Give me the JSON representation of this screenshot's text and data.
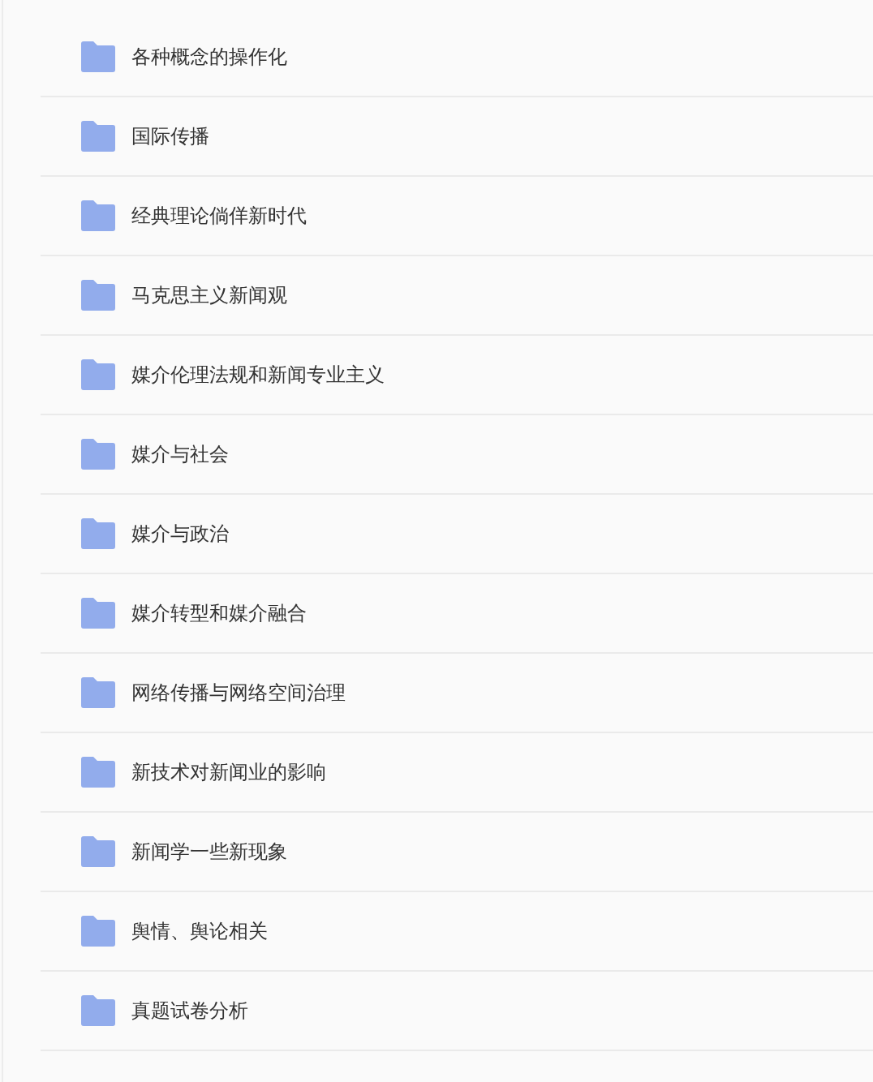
{
  "folders": [
    {
      "name": "各种概念的操作化"
    },
    {
      "name": "国际传播"
    },
    {
      "name": "经典理论倘佯新时代"
    },
    {
      "name": "马克思主义新闻观"
    },
    {
      "name": "媒介伦理法规和新闻专业主义"
    },
    {
      "name": "媒介与社会"
    },
    {
      "name": "媒介与政治"
    },
    {
      "name": "媒介转型和媒介融合"
    },
    {
      "name": "网络传播与网络空间治理"
    },
    {
      "name": "新技术对新闻业的影响"
    },
    {
      "name": "新闻学一些新现象"
    },
    {
      "name": "舆情、舆论相关"
    },
    {
      "name": "真题试卷分析"
    }
  ]
}
